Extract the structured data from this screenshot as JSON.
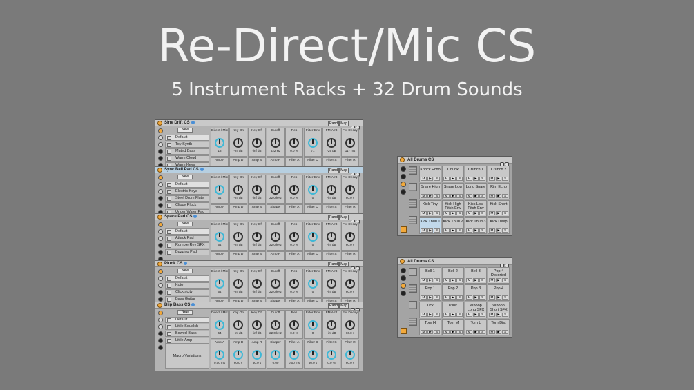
{
  "title": "Re-Direct/Mic CS",
  "subtitle": "5 Instrument Racks  + 32 Drum Sounds",
  "header_buttons": {
    "rand": "Rand",
    "map": "Map"
  },
  "new_label": "New",
  "macro_variations": "Macro Variations",
  "racks": [
    {
      "name": "Sine Drift CS",
      "chains": [
        "Default",
        "Toy Synth",
        "Muted Bass",
        "Warm Cloud",
        "Warm Keys"
      ],
      "row1": [
        {
          "label": "Direct / Mic",
          "value": "18"
        },
        {
          "label": "Key On",
          "value": "-inf dB"
        },
        {
          "label": "Key Off",
          "value": "-inf dB"
        },
        {
          "label": "Cutoff",
          "value": "522 Hz"
        },
        {
          "label": "Res",
          "value": "0.0 %"
        },
        {
          "label": "Filter Env",
          "value": "71"
        },
        {
          "label": "FM Amt",
          "value": "-29 dB"
        },
        {
          "label": "FM Decay",
          "value": "117 ms"
        }
      ],
      "row2": [
        "Amp A",
        "Amp D",
        "Amp S",
        "Amp R",
        "Filter A",
        "Filter D",
        "Filter S",
        "Filter R"
      ]
    },
    {
      "name": "Sync Bell Pad CS",
      "chains": [
        "Default",
        "Electric Keys",
        "Steel Drum Flute",
        "Clippy Pluck",
        "Under Water Pad"
      ],
      "row1": [
        {
          "label": "Direct / Mic",
          "value": "64"
        },
        {
          "label": "Key On",
          "value": "-inf dB"
        },
        {
          "label": "Key Off",
          "value": "-inf dB"
        },
        {
          "label": "Cutoff",
          "value": "22.0 kHz"
        },
        {
          "label": "Res",
          "value": "0.0 %"
        },
        {
          "label": "Filter Env",
          "value": "0"
        },
        {
          "label": "FM Amt",
          "value": "-inf dB"
        },
        {
          "label": "FM Decay",
          "value": "60.0 s"
        }
      ],
      "row2": [
        "Amp A",
        "Amp D",
        "Amp S",
        "Shaper",
        "Filter A",
        "Filter D",
        "Filter S",
        "Filter R"
      ]
    },
    {
      "name": "Space Pad CS",
      "chains": [
        "Default",
        "Attack Pad",
        "Rumble Rev SFX",
        "Buzzing Pad"
      ],
      "row1": [
        {
          "label": "Direct / Mic",
          "value": "64"
        },
        {
          "label": "Key On",
          "value": "-inf dB"
        },
        {
          "label": "Key Off",
          "value": "-inf dB"
        },
        {
          "label": "Cutoff",
          "value": "22.0 kHz"
        },
        {
          "label": "Res",
          "value": "0.0 %"
        },
        {
          "label": "Filter Env",
          "value": "0"
        },
        {
          "label": "FM Amt",
          "value": "-inf dB"
        },
        {
          "label": "FM Decay",
          "value": "60.0 s"
        }
      ],
      "row2": [
        "Amp A",
        "Amp D",
        "Amp S",
        "Amp R",
        "Filter A",
        "Filter D",
        "Filter S",
        "Filter R"
      ]
    },
    {
      "name": "Plunk CS",
      "chains": [
        "Default",
        "Koto",
        "Clicktricity",
        "Bass Guitar"
      ],
      "row1": [
        {
          "label": "Direct / Mic",
          "value": "64"
        },
        {
          "label": "Key On",
          "value": "-inf dB"
        },
        {
          "label": "Key Off",
          "value": "-inf dB"
        },
        {
          "label": "Cutoff",
          "value": "22.0 kHz"
        },
        {
          "label": "Res",
          "value": "0.0 %"
        },
        {
          "label": "Filter Env",
          "value": "0"
        },
        {
          "label": "FM Amt",
          "value": "-inf dB"
        },
        {
          "label": "FM Decay",
          "value": "60.0 s"
        }
      ],
      "row2": [
        "Amp A",
        "Amp D",
        "Amp S",
        "Shaper",
        "Filter A",
        "Filter D",
        "Filter S",
        "Filter R"
      ]
    },
    {
      "name": "Blip Bass CS",
      "chains": [
        "Default",
        "Little Squelch",
        "Bowed Bass",
        "Little Amp"
      ],
      "row1": [
        {
          "label": "Direct / Mic",
          "value": "64"
        },
        {
          "label": "Key On",
          "value": "-inf dB"
        },
        {
          "label": "Key Off",
          "value": "-inf dB"
        },
        {
          "label": "Cutoff",
          "value": "22.0 kHz"
        },
        {
          "label": "Res",
          "value": "0.0 %"
        },
        {
          "label": "Filter Env",
          "value": "0"
        },
        {
          "label": "FM Amt",
          "value": "-inf dB"
        },
        {
          "label": "FM Decay",
          "value": "60.0 s"
        }
      ],
      "row2": [
        {
          "label": "Amp A",
          "value": "0.00 ms"
        },
        {
          "label": "Amp D",
          "value": "60.0 s"
        },
        {
          "label": "Amp R",
          "value": "60.0 s"
        },
        {
          "label": "Shaper",
          "value": "0.00"
        },
        {
          "label": "Filter A",
          "value": "0.00 ms"
        },
        {
          "label": "Filter D",
          "value": "60.0 s"
        },
        {
          "label": "Filter S",
          "value": "0.0 %"
        },
        {
          "label": "Filter R",
          "value": "60.0 s"
        }
      ]
    }
  ],
  "drum_racks": [
    {
      "name": "All Drums CS",
      "pads": [
        "Knock Echo",
        "Chunk",
        "Crunch 1",
        "Crunch 2",
        "Snare High",
        "Snare Low",
        "Long Snare",
        "Rim Echo",
        "Kick Tiny",
        "Kick High Pitch Env",
        "Kick Low Pitch Env",
        "Kick Short",
        "Kick Thud 1",
        "Kick Thud 2",
        "Kick Thud 3",
        "Kick Deep"
      ]
    },
    {
      "name": "All Drums CS",
      "pads": [
        "Bell 1",
        "Bell 2",
        "Bell 3",
        "Pop 4 Distorted",
        "Pop 1",
        "Pop 2",
        "Pop 3",
        "Pop 4",
        "Tick",
        "Plink",
        "Whoop Long SFX",
        "Whoop Short SFX",
        "Tom H",
        "Tom M",
        "Tom L",
        "Tom Dist"
      ]
    }
  ],
  "pad_buttons": [
    "M",
    "▶",
    "S"
  ]
}
